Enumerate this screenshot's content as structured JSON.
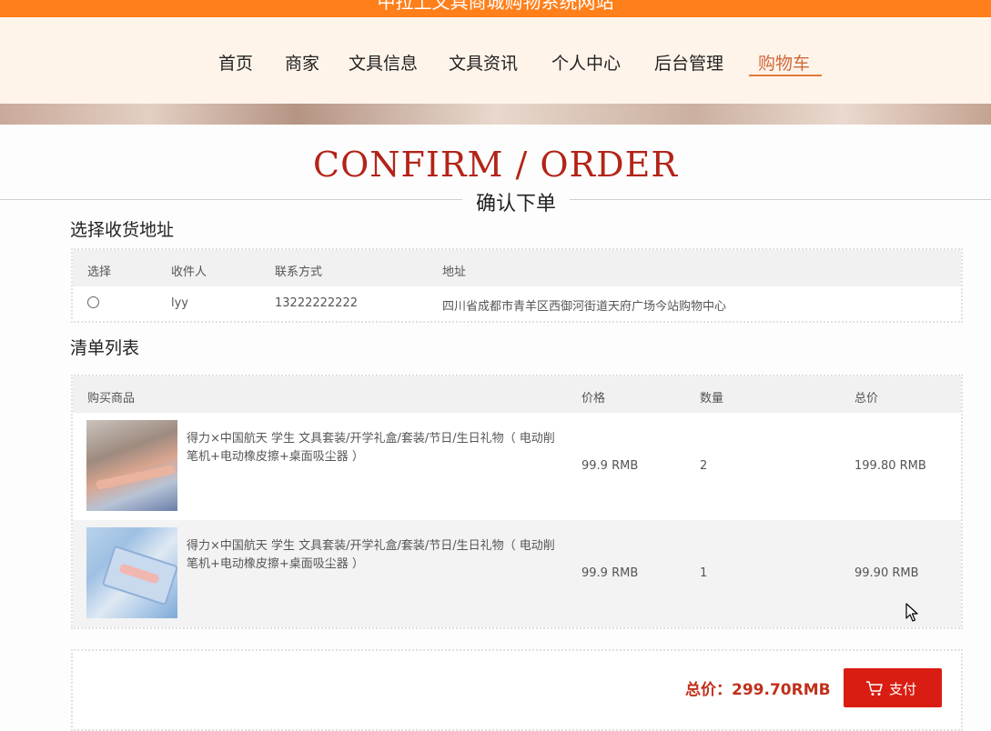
{
  "site": {
    "title": "中拉上文具商城购物系统网站"
  },
  "nav": {
    "items": [
      {
        "label": "首页"
      },
      {
        "label": "商家"
      },
      {
        "label": "文具信息"
      },
      {
        "label": "文具资讯"
      },
      {
        "label": "个人中心"
      },
      {
        "label": "后台管理"
      },
      {
        "label": "购物车",
        "active": true
      }
    ]
  },
  "page": {
    "heading_en": "CONFIRM / ORDER",
    "heading_cn": "确认下单"
  },
  "address_section": {
    "title": "选择收货地址",
    "columns": [
      "选择",
      "收件人",
      "联系方式",
      "地址"
    ],
    "rows": [
      {
        "selected": false,
        "recipient": "lyy",
        "phone": "13222222222",
        "address": "四川省成都市青羊区西御河街道天府广场今站购物中心"
      }
    ]
  },
  "order_section": {
    "title": "清单列表",
    "columns": [
      "购买商品",
      "价格",
      "数量",
      "总价"
    ],
    "rows": [
      {
        "name": "得力×中国航天 学生 文具套装/开学礼盒/套装/节日/生日礼物（ 电动削笔机+电动橡皮擦+桌面吸尘器 ）",
        "price": "99.9 RMB",
        "quantity": "2",
        "total": "199.80 RMB"
      },
      {
        "name": "得力×中国航天 学生 文具套装/开学礼盒/套装/节日/生日礼物（ 电动削笔机+电动橡皮擦+桌面吸尘器 ）",
        "price": "99.9 RMB",
        "quantity": "1",
        "total": "99.90 RMB"
      }
    ]
  },
  "summary": {
    "total_label": "总价：299.70RMB",
    "pay_button": "支付"
  },
  "colors": {
    "topbar": "#ff7f1a",
    "nav_bg": "#fff4ea",
    "nav_active": "#d1683a",
    "heading_en": "#b32418",
    "pay_button": "#d91d12",
    "total_text": "#c0301a"
  },
  "icons": {
    "pay_button_icon": "cart-icon",
    "pointer": "mouse-cursor-icon"
  }
}
